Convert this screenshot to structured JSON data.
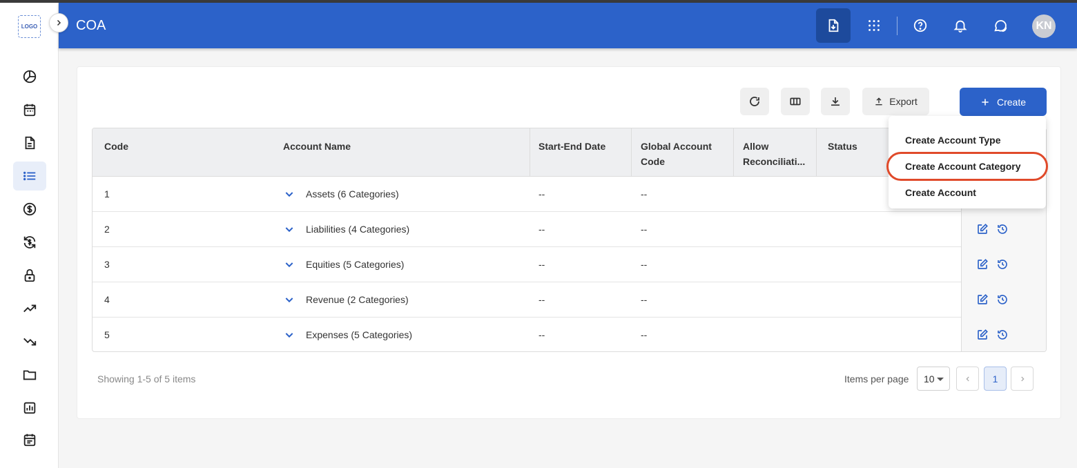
{
  "app": {
    "logo_text": "LOGO",
    "page_title": "COA",
    "avatar_initials": "KN",
    "brand_color": "#2c62c9"
  },
  "sidebar": {
    "items": [
      {
        "icon": "pie-chart-icon"
      },
      {
        "icon": "calendar-icon"
      },
      {
        "icon": "document-icon"
      },
      {
        "icon": "list-icon",
        "active": true
      },
      {
        "icon": "dollar-icon"
      },
      {
        "icon": "dollar-sync-icon"
      },
      {
        "icon": "lock-icon"
      },
      {
        "icon": "trending-up-icon"
      },
      {
        "icon": "trending-down-icon"
      },
      {
        "icon": "folder-icon"
      },
      {
        "icon": "report-icon"
      },
      {
        "icon": "notes-icon"
      }
    ]
  },
  "header": {
    "buttons": [
      "file-download-icon",
      "apps-grid-icon",
      "help-icon",
      "bell-icon",
      "chat-icon"
    ]
  },
  "toolbar": {
    "export_label": "Export",
    "create_label": "Create"
  },
  "dropdown": {
    "items": [
      "Create Account Type",
      "Create Account Category",
      "Create Account"
    ],
    "highlighted_index": 1
  },
  "table": {
    "columns": [
      "Code",
      "Account Name",
      "Start-End Date",
      "Global Account Code",
      "Allow Reconciliati...",
      "Status"
    ],
    "column_lines": {
      "global_account_code": [
        "Global Account",
        "Code"
      ],
      "allow_reconciliation": [
        "Allow",
        "Reconciliati..."
      ]
    },
    "rows": [
      {
        "code": "1",
        "name": "Assets (6 Categories)",
        "dates": "--",
        "global_code": "--",
        "allow": "",
        "status": ""
      },
      {
        "code": "2",
        "name": "Liabilities (4 Categories)",
        "dates": "--",
        "global_code": "--",
        "allow": "",
        "status": ""
      },
      {
        "code": "3",
        "name": "Equities (5 Categories)",
        "dates": "--",
        "global_code": "--",
        "allow": "",
        "status": ""
      },
      {
        "code": "4",
        "name": "Revenue (2 Categories)",
        "dates": "--",
        "global_code": "--",
        "allow": "",
        "status": ""
      },
      {
        "code": "5",
        "name": "Expenses (5 Categories)",
        "dates": "--",
        "global_code": "--",
        "allow": "",
        "status": ""
      }
    ]
  },
  "footer": {
    "showing": "Showing 1-5 of 5 items",
    "items_per_page_label": "Items per page",
    "items_per_page_value": "10",
    "current_page": "1"
  }
}
